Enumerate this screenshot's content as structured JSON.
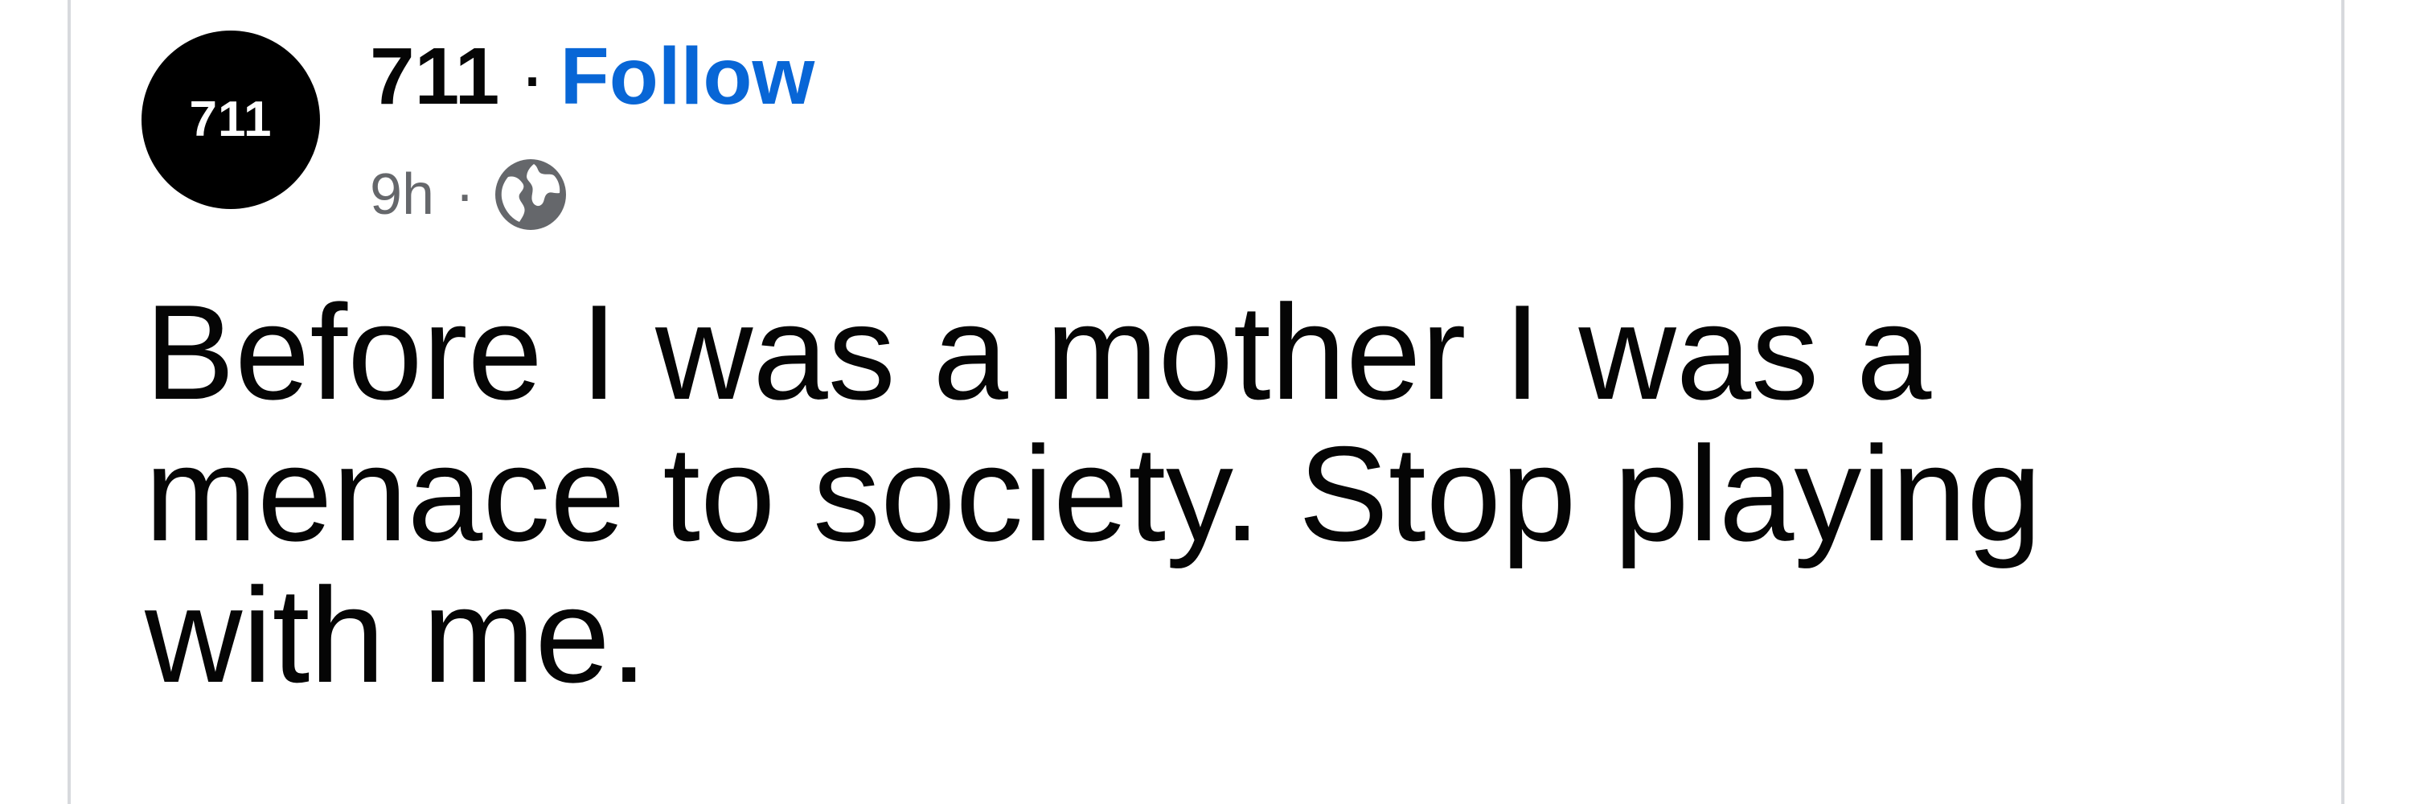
{
  "post": {
    "avatar_text": "711",
    "author": "711",
    "separator": "·",
    "follow_label": "Follow",
    "time": "9h",
    "meta_separator": "·",
    "audience_icon": "globe-icon",
    "text": "Before I was a mother I was a menace to society. Stop playing with me."
  },
  "colors": {
    "follow": "#0866d6",
    "meta": "#65676b",
    "avatar_bg": "#000000",
    "border": "#d7d9dd"
  }
}
